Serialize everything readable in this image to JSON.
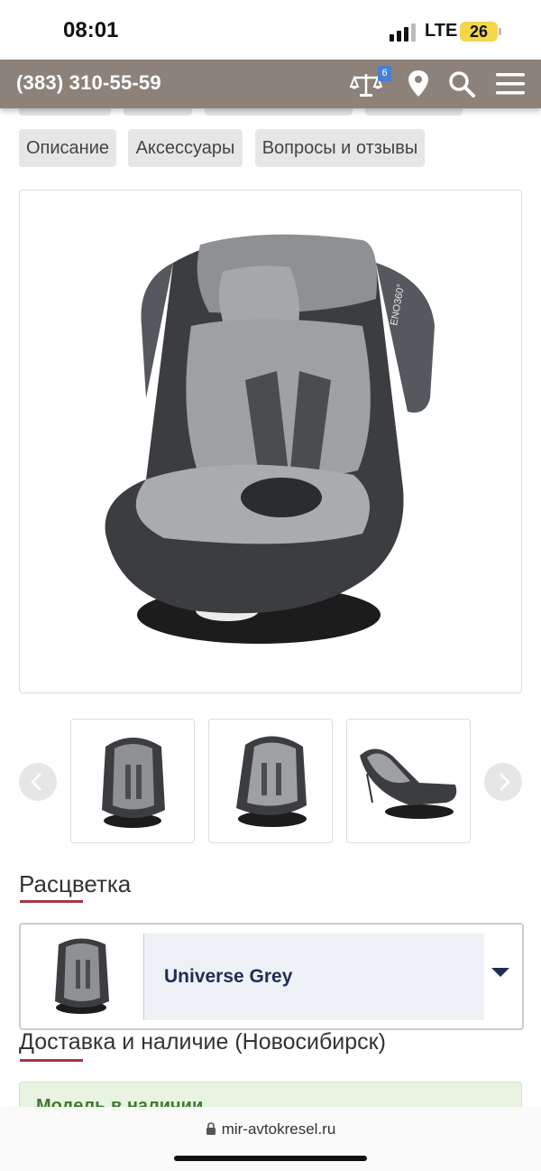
{
  "status_bar": {
    "time": "08:01",
    "network": "LTE",
    "battery": "26"
  },
  "header": {
    "phone": "(383) 310-55-59",
    "compare_count": "6",
    "icons": [
      "scales-icon",
      "location-pin-icon",
      "search-icon",
      "menu-icon"
    ]
  },
  "tabs": [
    {
      "label": "Описание"
    },
    {
      "label": "Аксессуары"
    },
    {
      "label": "Вопросы и отзывы"
    }
  ],
  "color_section": {
    "title": "Расцветка",
    "selected": "Universe Grey"
  },
  "delivery_section": {
    "title": "Доставка и наличие (Новосибирск)",
    "availability": "Модель в наличии"
  },
  "browser": {
    "url": "mir-avtokresel.ru"
  },
  "colors": {
    "header_bg": "#8c8279",
    "accent_underline": "#a83546",
    "color_name": "#1d2e55"
  }
}
